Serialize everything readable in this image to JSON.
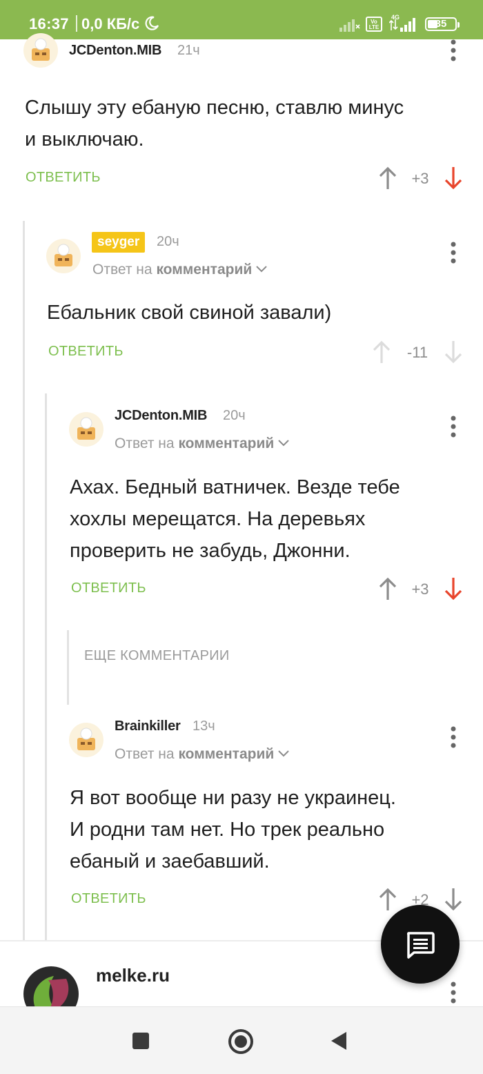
{
  "status_bar": {
    "time": "16:37",
    "speed": "0,0 КБ/с",
    "network": "4G",
    "volte": "Vo LTE",
    "battery": "35"
  },
  "comments": [
    {
      "username": "JCDenton.MIB",
      "time": "21ч",
      "text_lines": [
        "Слышу эту ебаную песню, ставлю минус",
        "и выключаю."
      ],
      "reply": "ОТВЕТИТЬ",
      "score": "+3",
      "vote_state": "down"
    },
    {
      "username": "seyger",
      "time": "20ч",
      "reply_prefix": "Ответ на",
      "reply_target": "комментарий",
      "text_lines": [
        "Ебальник свой свиной завали)"
      ],
      "reply": "ОТВЕТИТЬ",
      "score": "-11",
      "vote_state": "none-faded"
    },
    {
      "username": "JCDenton.MIB",
      "time": "20ч",
      "reply_prefix": "Ответ на",
      "reply_target": "комментарий",
      "text_lines": [
        "Ахах. Бедный ватничек. Везде тебе",
        "хохлы мерещатся. На деревьях",
        "проверить не забудь, Джонни."
      ],
      "reply": "ОТВЕТИТЬ",
      "score": "+3",
      "vote_state": "down"
    },
    {
      "username": "Brainkiller",
      "time": "13ч",
      "reply_prefix": "Ответ на",
      "reply_target": "комментарий",
      "text_lines": [
        "Я вот вообще ни разу не украинец.",
        "И родни там нет. Но трек реально",
        "ебаный и заебавший."
      ],
      "reply": "ОТВЕТИТЬ",
      "score": "+2",
      "vote_state": "none"
    }
  ],
  "more_comments": "ЕЩЕ КОММЕНТАРИИ",
  "promo": {
    "name": "melke.ru"
  },
  "colors": {
    "status_bar": "#8bb950",
    "reply_link": "#7dbf4e",
    "downvote_active": "#e8452c",
    "badge": "#f5c518"
  }
}
